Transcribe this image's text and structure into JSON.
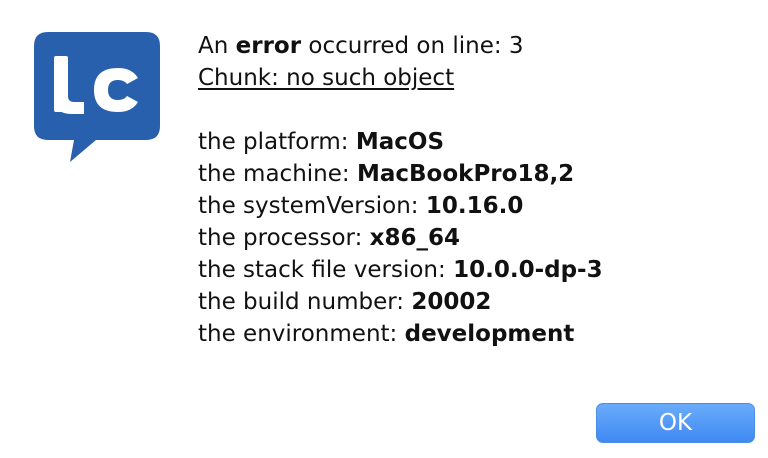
{
  "logo": {
    "text": "lc",
    "color": "#2860ae"
  },
  "message": {
    "error_prefix": "An ",
    "error_word": "error",
    "error_suffix": " occurred on line: 3",
    "chunk_line": "Chunk: no such object",
    "details": [
      {
        "label": "the platform: ",
        "value": "MacOS"
      },
      {
        "label": "the machine: ",
        "value": "MacBookPro18,2"
      },
      {
        "label": "the systemVersion: ",
        "value": "10.16.0"
      },
      {
        "label": "the processor: ",
        "value": "x86_64"
      },
      {
        "label": "the stack file version: ",
        "value": "10.0.0-dp-3"
      },
      {
        "label": "the build number: ",
        "value": "20002"
      },
      {
        "label": "the environment: ",
        "value": "development"
      }
    ]
  },
  "buttons": {
    "ok_label": "OK",
    "ok_color": "#3f89f2"
  }
}
